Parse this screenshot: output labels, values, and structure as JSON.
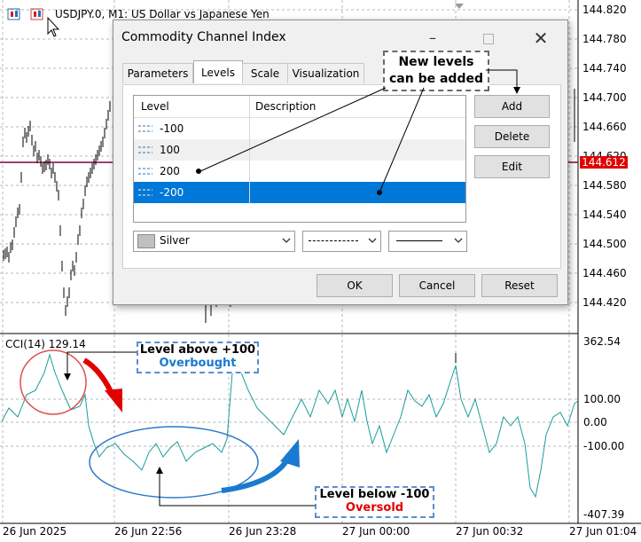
{
  "chart": {
    "symbol_title": "USDJPY.0, M1:  US Dollar vs Japanese Yen",
    "current_price": "144.612",
    "price_scale": [
      "144.820",
      "144.780",
      "144.740",
      "144.700",
      "144.660",
      "144.620",
      "144.580",
      "144.540",
      "144.500",
      "144.460",
      "144.420"
    ],
    "indicator_label": "CCI(14) 129.14",
    "indicator_scale": [
      "362.54",
      "100.00",
      "0.00",
      "-100.00",
      "-407.39"
    ],
    "time_axis": [
      "26 Jun 2025",
      "26 Jun 22:56",
      "26 Jun 23:28",
      "27 Jun 00:00",
      "27 Jun 00:32",
      "27 Jun 01:04"
    ],
    "colors": {
      "price_line": "#800040",
      "price_tag": "#e00000",
      "cci_line": "#1a9c9c",
      "arrow_red": "#e00000",
      "arrow_blue": "#1a7ad0",
      "ellipse_red": "#e05050",
      "ellipse_blue": "#2a7ac8"
    }
  },
  "dialog": {
    "title": "Commodity Channel Index",
    "tabs": [
      "Parameters",
      "Levels",
      "Scale",
      "Visualization"
    ],
    "active_tab": "Levels",
    "table_headers": {
      "level": "Level",
      "description": "Description"
    },
    "levels": [
      {
        "value": "-100",
        "description": ""
      },
      {
        "value": "100",
        "description": ""
      },
      {
        "value": "200",
        "description": ""
      },
      {
        "value": "-200",
        "description": ""
      }
    ],
    "selected_level_index": 3,
    "buttons": {
      "add": "Add",
      "delete": "Delete",
      "edit": "Edit",
      "ok": "OK",
      "cancel": "Cancel",
      "reset": "Reset"
    },
    "color_combo": "Silver",
    "window_icons": [
      "minimize-icon",
      "maximize-icon",
      "close-icon"
    ]
  },
  "annotations": {
    "new_levels_line1": "New levels",
    "new_levels_line2": "can be added",
    "above_line1": "Level above +100",
    "above_line2": "Overbought",
    "below_line1": "Level below -100",
    "below_line2": "Oversold"
  }
}
